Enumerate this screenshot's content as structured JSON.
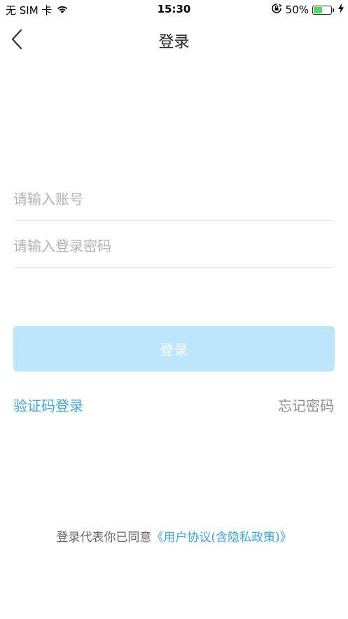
{
  "status_bar": {
    "carrier": "无 SIM 卡",
    "time": "15:30",
    "battery_percent": "50%",
    "battery_level": 0.5,
    "icons": [
      "wifi-icon",
      "orientation-lock-icon",
      "battery-icon",
      "charging-icon"
    ]
  },
  "nav": {
    "title": "登录",
    "back_icon": "chevron-left-icon"
  },
  "form": {
    "account_placeholder": "请输入账号",
    "password_placeholder": "请输入登录密码",
    "login_button": "登录"
  },
  "links": {
    "sms_login": "验证码登录",
    "forgot_password": "忘记密码"
  },
  "agreement": {
    "prefix": "登录代表你已同意",
    "link": "《用户协议(含隐私政策)》"
  },
  "colors": {
    "accent": "#3ba7e8",
    "button_disabled": "#bde6fc",
    "battery": "#4cd964"
  }
}
